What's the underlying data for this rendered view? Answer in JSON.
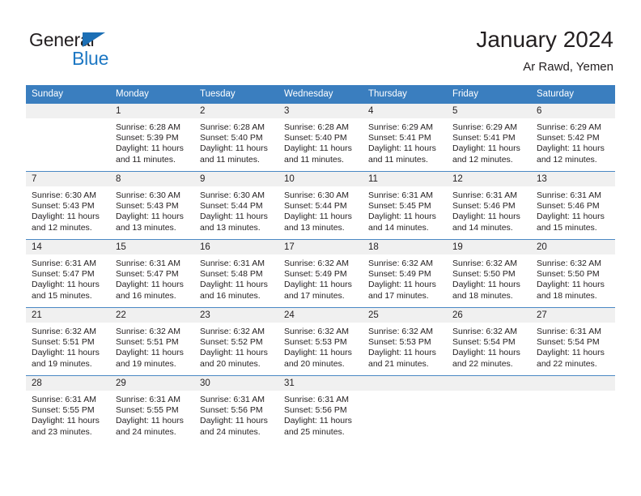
{
  "brand": {
    "name_part1": "General",
    "name_part2": "Blue",
    "triangle_icon": "triangle-icon",
    "accent_color": "#1c77c3"
  },
  "header": {
    "title": "January 2024",
    "subtitle": "Ar Rawd, Yemen"
  },
  "calendar": {
    "header_background": "#3a7ebf",
    "daynum_background": "#f0f0f0",
    "weekday_headers": [
      "Sunday",
      "Monday",
      "Tuesday",
      "Wednesday",
      "Thursday",
      "Friday",
      "Saturday"
    ],
    "weeks": [
      [
        {
          "day": "",
          "lines": [
            "",
            "",
            "",
            ""
          ]
        },
        {
          "day": "1",
          "lines": [
            "Sunrise: 6:28 AM",
            "Sunset: 5:39 PM",
            "Daylight: 11 hours",
            "and 11 minutes."
          ]
        },
        {
          "day": "2",
          "lines": [
            "Sunrise: 6:28 AM",
            "Sunset: 5:40 PM",
            "Daylight: 11 hours",
            "and 11 minutes."
          ]
        },
        {
          "day": "3",
          "lines": [
            "Sunrise: 6:28 AM",
            "Sunset: 5:40 PM",
            "Daylight: 11 hours",
            "and 11 minutes."
          ]
        },
        {
          "day": "4",
          "lines": [
            "Sunrise: 6:29 AM",
            "Sunset: 5:41 PM",
            "Daylight: 11 hours",
            "and 11 minutes."
          ]
        },
        {
          "day": "5",
          "lines": [
            "Sunrise: 6:29 AM",
            "Sunset: 5:41 PM",
            "Daylight: 11 hours",
            "and 12 minutes."
          ]
        },
        {
          "day": "6",
          "lines": [
            "Sunrise: 6:29 AM",
            "Sunset: 5:42 PM",
            "Daylight: 11 hours",
            "and 12 minutes."
          ]
        }
      ],
      [
        {
          "day": "7",
          "lines": [
            "Sunrise: 6:30 AM",
            "Sunset: 5:43 PM",
            "Daylight: 11 hours",
            "and 12 minutes."
          ]
        },
        {
          "day": "8",
          "lines": [
            "Sunrise: 6:30 AM",
            "Sunset: 5:43 PM",
            "Daylight: 11 hours",
            "and 13 minutes."
          ]
        },
        {
          "day": "9",
          "lines": [
            "Sunrise: 6:30 AM",
            "Sunset: 5:44 PM",
            "Daylight: 11 hours",
            "and 13 minutes."
          ]
        },
        {
          "day": "10",
          "lines": [
            "Sunrise: 6:30 AM",
            "Sunset: 5:44 PM",
            "Daylight: 11 hours",
            "and 13 minutes."
          ]
        },
        {
          "day": "11",
          "lines": [
            "Sunrise: 6:31 AM",
            "Sunset: 5:45 PM",
            "Daylight: 11 hours",
            "and 14 minutes."
          ]
        },
        {
          "day": "12",
          "lines": [
            "Sunrise: 6:31 AM",
            "Sunset: 5:46 PM",
            "Daylight: 11 hours",
            "and 14 minutes."
          ]
        },
        {
          "day": "13",
          "lines": [
            "Sunrise: 6:31 AM",
            "Sunset: 5:46 PM",
            "Daylight: 11 hours",
            "and 15 minutes."
          ]
        }
      ],
      [
        {
          "day": "14",
          "lines": [
            "Sunrise: 6:31 AM",
            "Sunset: 5:47 PM",
            "Daylight: 11 hours",
            "and 15 minutes."
          ]
        },
        {
          "day": "15",
          "lines": [
            "Sunrise: 6:31 AM",
            "Sunset: 5:47 PM",
            "Daylight: 11 hours",
            "and 16 minutes."
          ]
        },
        {
          "day": "16",
          "lines": [
            "Sunrise: 6:31 AM",
            "Sunset: 5:48 PM",
            "Daylight: 11 hours",
            "and 16 minutes."
          ]
        },
        {
          "day": "17",
          "lines": [
            "Sunrise: 6:32 AM",
            "Sunset: 5:49 PM",
            "Daylight: 11 hours",
            "and 17 minutes."
          ]
        },
        {
          "day": "18",
          "lines": [
            "Sunrise: 6:32 AM",
            "Sunset: 5:49 PM",
            "Daylight: 11 hours",
            "and 17 minutes."
          ]
        },
        {
          "day": "19",
          "lines": [
            "Sunrise: 6:32 AM",
            "Sunset: 5:50 PM",
            "Daylight: 11 hours",
            "and 18 minutes."
          ]
        },
        {
          "day": "20",
          "lines": [
            "Sunrise: 6:32 AM",
            "Sunset: 5:50 PM",
            "Daylight: 11 hours",
            "and 18 minutes."
          ]
        }
      ],
      [
        {
          "day": "21",
          "lines": [
            "Sunrise: 6:32 AM",
            "Sunset: 5:51 PM",
            "Daylight: 11 hours",
            "and 19 minutes."
          ]
        },
        {
          "day": "22",
          "lines": [
            "Sunrise: 6:32 AM",
            "Sunset: 5:51 PM",
            "Daylight: 11 hours",
            "and 19 minutes."
          ]
        },
        {
          "day": "23",
          "lines": [
            "Sunrise: 6:32 AM",
            "Sunset: 5:52 PM",
            "Daylight: 11 hours",
            "and 20 minutes."
          ]
        },
        {
          "day": "24",
          "lines": [
            "Sunrise: 6:32 AM",
            "Sunset: 5:53 PM",
            "Daylight: 11 hours",
            "and 20 minutes."
          ]
        },
        {
          "day": "25",
          "lines": [
            "Sunrise: 6:32 AM",
            "Sunset: 5:53 PM",
            "Daylight: 11 hours",
            "and 21 minutes."
          ]
        },
        {
          "day": "26",
          "lines": [
            "Sunrise: 6:32 AM",
            "Sunset: 5:54 PM",
            "Daylight: 11 hours",
            "and 22 minutes."
          ]
        },
        {
          "day": "27",
          "lines": [
            "Sunrise: 6:31 AM",
            "Sunset: 5:54 PM",
            "Daylight: 11 hours",
            "and 22 minutes."
          ]
        }
      ],
      [
        {
          "day": "28",
          "lines": [
            "Sunrise: 6:31 AM",
            "Sunset: 5:55 PM",
            "Daylight: 11 hours",
            "and 23 minutes."
          ]
        },
        {
          "day": "29",
          "lines": [
            "Sunrise: 6:31 AM",
            "Sunset: 5:55 PM",
            "Daylight: 11 hours",
            "and 24 minutes."
          ]
        },
        {
          "day": "30",
          "lines": [
            "Sunrise: 6:31 AM",
            "Sunset: 5:56 PM",
            "Daylight: 11 hours",
            "and 24 minutes."
          ]
        },
        {
          "day": "31",
          "lines": [
            "Sunrise: 6:31 AM",
            "Sunset: 5:56 PM",
            "Daylight: 11 hours",
            "and 25 minutes."
          ]
        },
        {
          "day": "",
          "lines": [
            "",
            "",
            "",
            ""
          ]
        },
        {
          "day": "",
          "lines": [
            "",
            "",
            "",
            ""
          ]
        },
        {
          "day": "",
          "lines": [
            "",
            "",
            "",
            ""
          ]
        }
      ]
    ]
  }
}
